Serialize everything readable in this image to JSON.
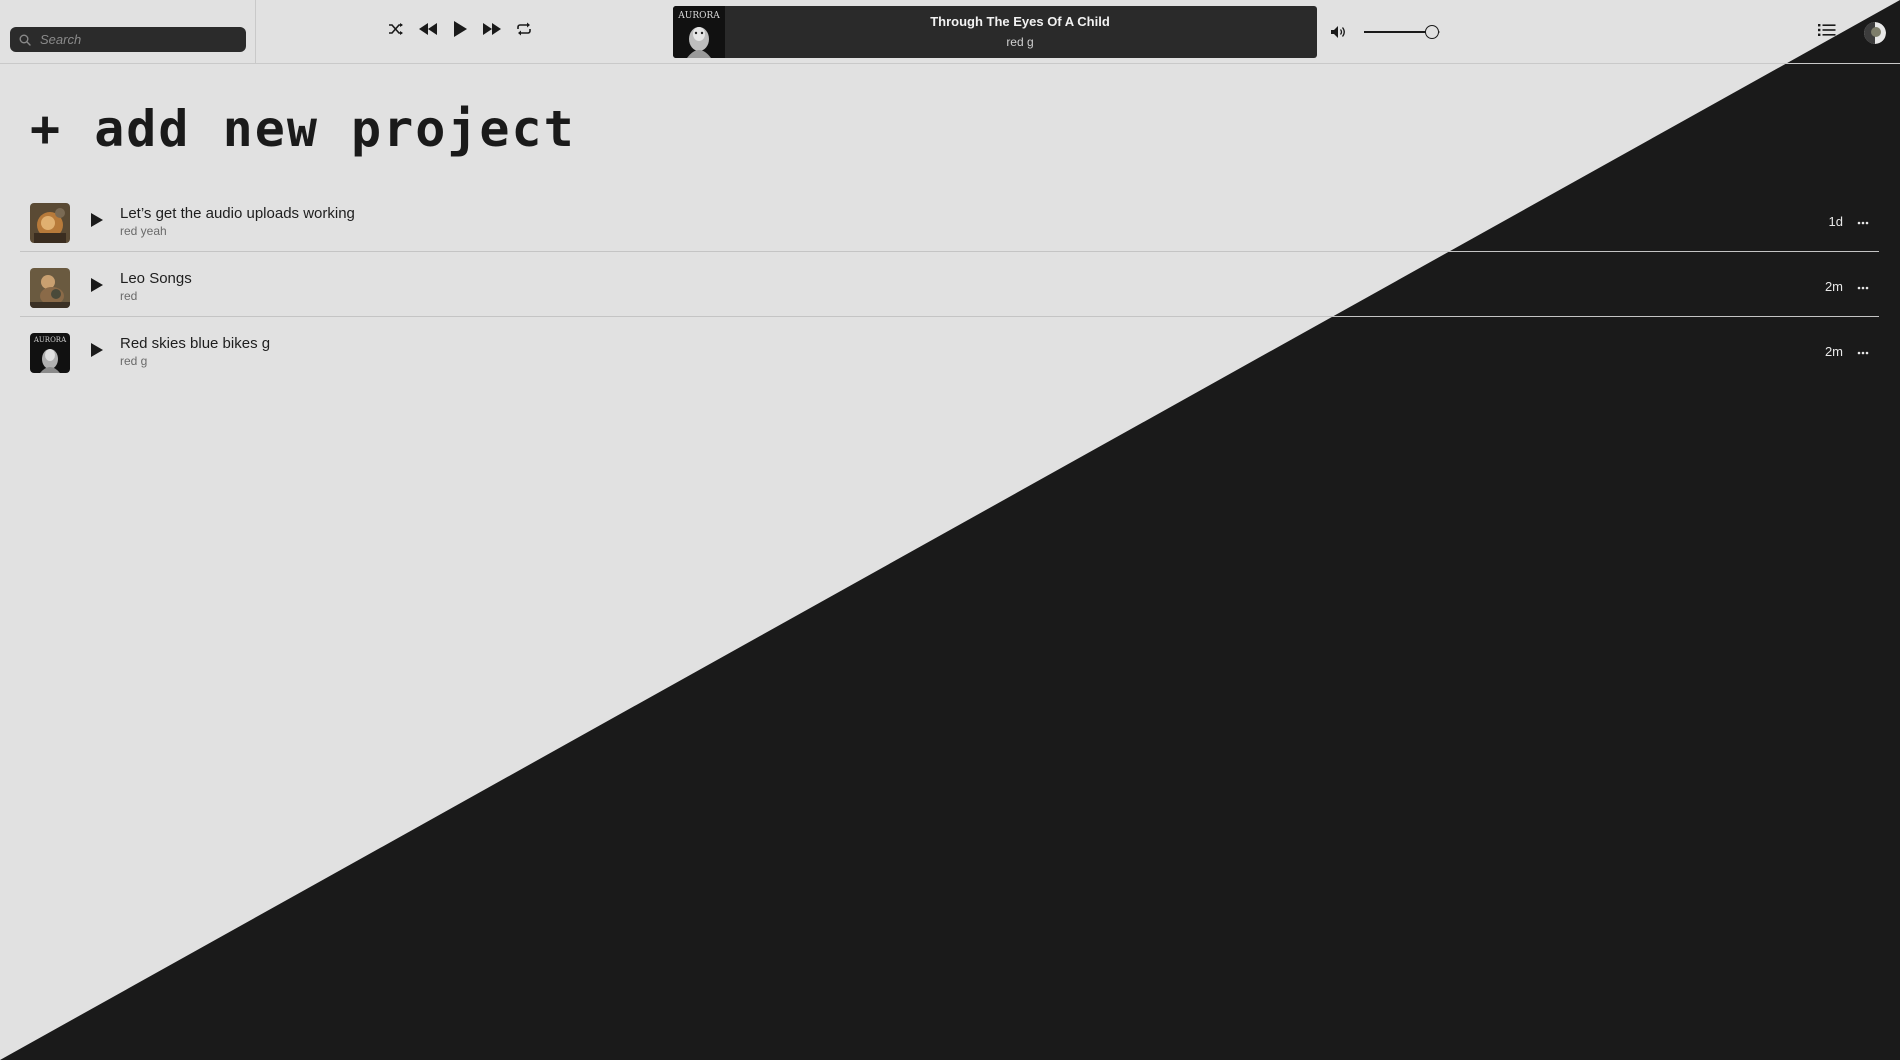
{
  "colors": {
    "background": "#e1e1e1",
    "dark": "#1a1a1a",
    "player_bg": "#2a2a2a",
    "search_bg": "#2b2b2b"
  },
  "search": {
    "placeholder": "Search",
    "icon": "search-icon"
  },
  "player_controls": {
    "shuffle_icon": "shuffle-icon",
    "previous_icon": "rewind-icon",
    "play_icon": "play-icon",
    "next_icon": "fast-forward-icon",
    "repeat_icon": "repeat-icon"
  },
  "now_playing": {
    "title": "Through The Eyes Of A Child",
    "artist": "red g",
    "art_text": "AURORA"
  },
  "volume": {
    "icon": "speaker-icon",
    "level": 0.9
  },
  "header_actions": {
    "queue_icon": "list-icon",
    "avatar_icon": "avatar"
  },
  "main": {
    "add_project_label": "+ add new project"
  },
  "projects": [
    {
      "title": "Let’s get the audio uploads working",
      "subtitle": "red yeah",
      "age": "1d"
    },
    {
      "title": "Leo Songs",
      "subtitle": "red",
      "age": "2m"
    },
    {
      "title": "Red skies blue bikes g",
      "subtitle": "red g",
      "age": "2m"
    }
  ]
}
